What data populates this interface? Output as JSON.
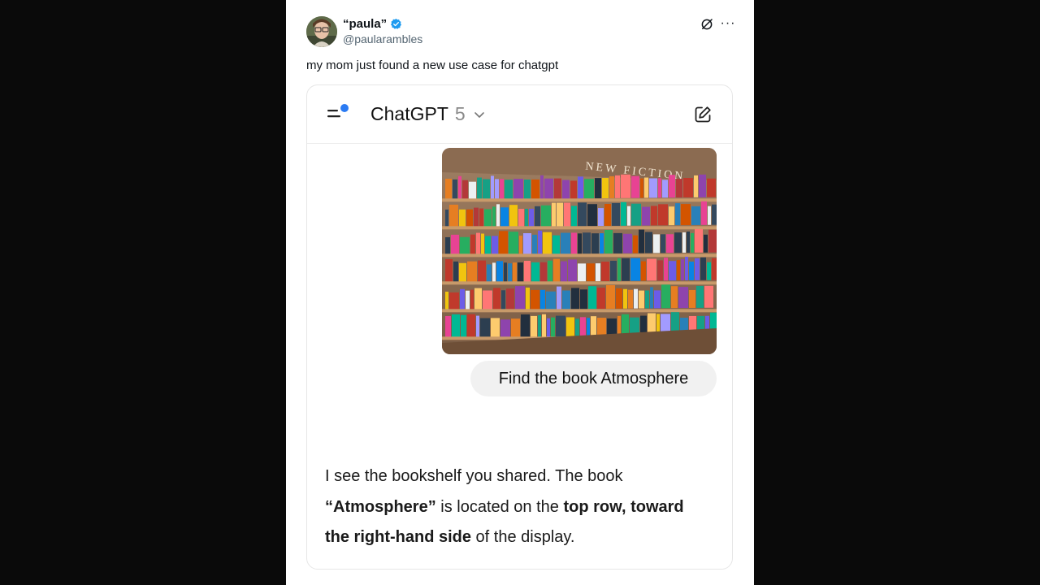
{
  "post": {
    "display_name": "“paula”",
    "handle": "@paularambles",
    "text": "my mom just found a new use case for chatgpt",
    "verified": true,
    "icons": [
      "grok-icon",
      "more-icon"
    ],
    "more_label": "···"
  },
  "chat": {
    "app_name": "ChatGPT",
    "model_version": "5",
    "icons": [
      "sidebar-menu-icon",
      "chevron-down-icon",
      "new-chat-icon"
    ],
    "image_sign": "NEW FICTION",
    "user_message": "Find the book Atmosphere",
    "reply": {
      "line1": "I see the bookshelf you shared. The book",
      "book": "“Atmosphere”",
      "mid": " is located on the ",
      "bold_location_a": "top row, toward",
      "bold_location_b": "the right-hand side",
      "tail": " of the display."
    }
  },
  "colors": {
    "background": "#0a0a0a",
    "verified_blue": "#1d9bf0",
    "bubble": "#f1f1f1",
    "accent_dot": "#2b7bf3"
  }
}
